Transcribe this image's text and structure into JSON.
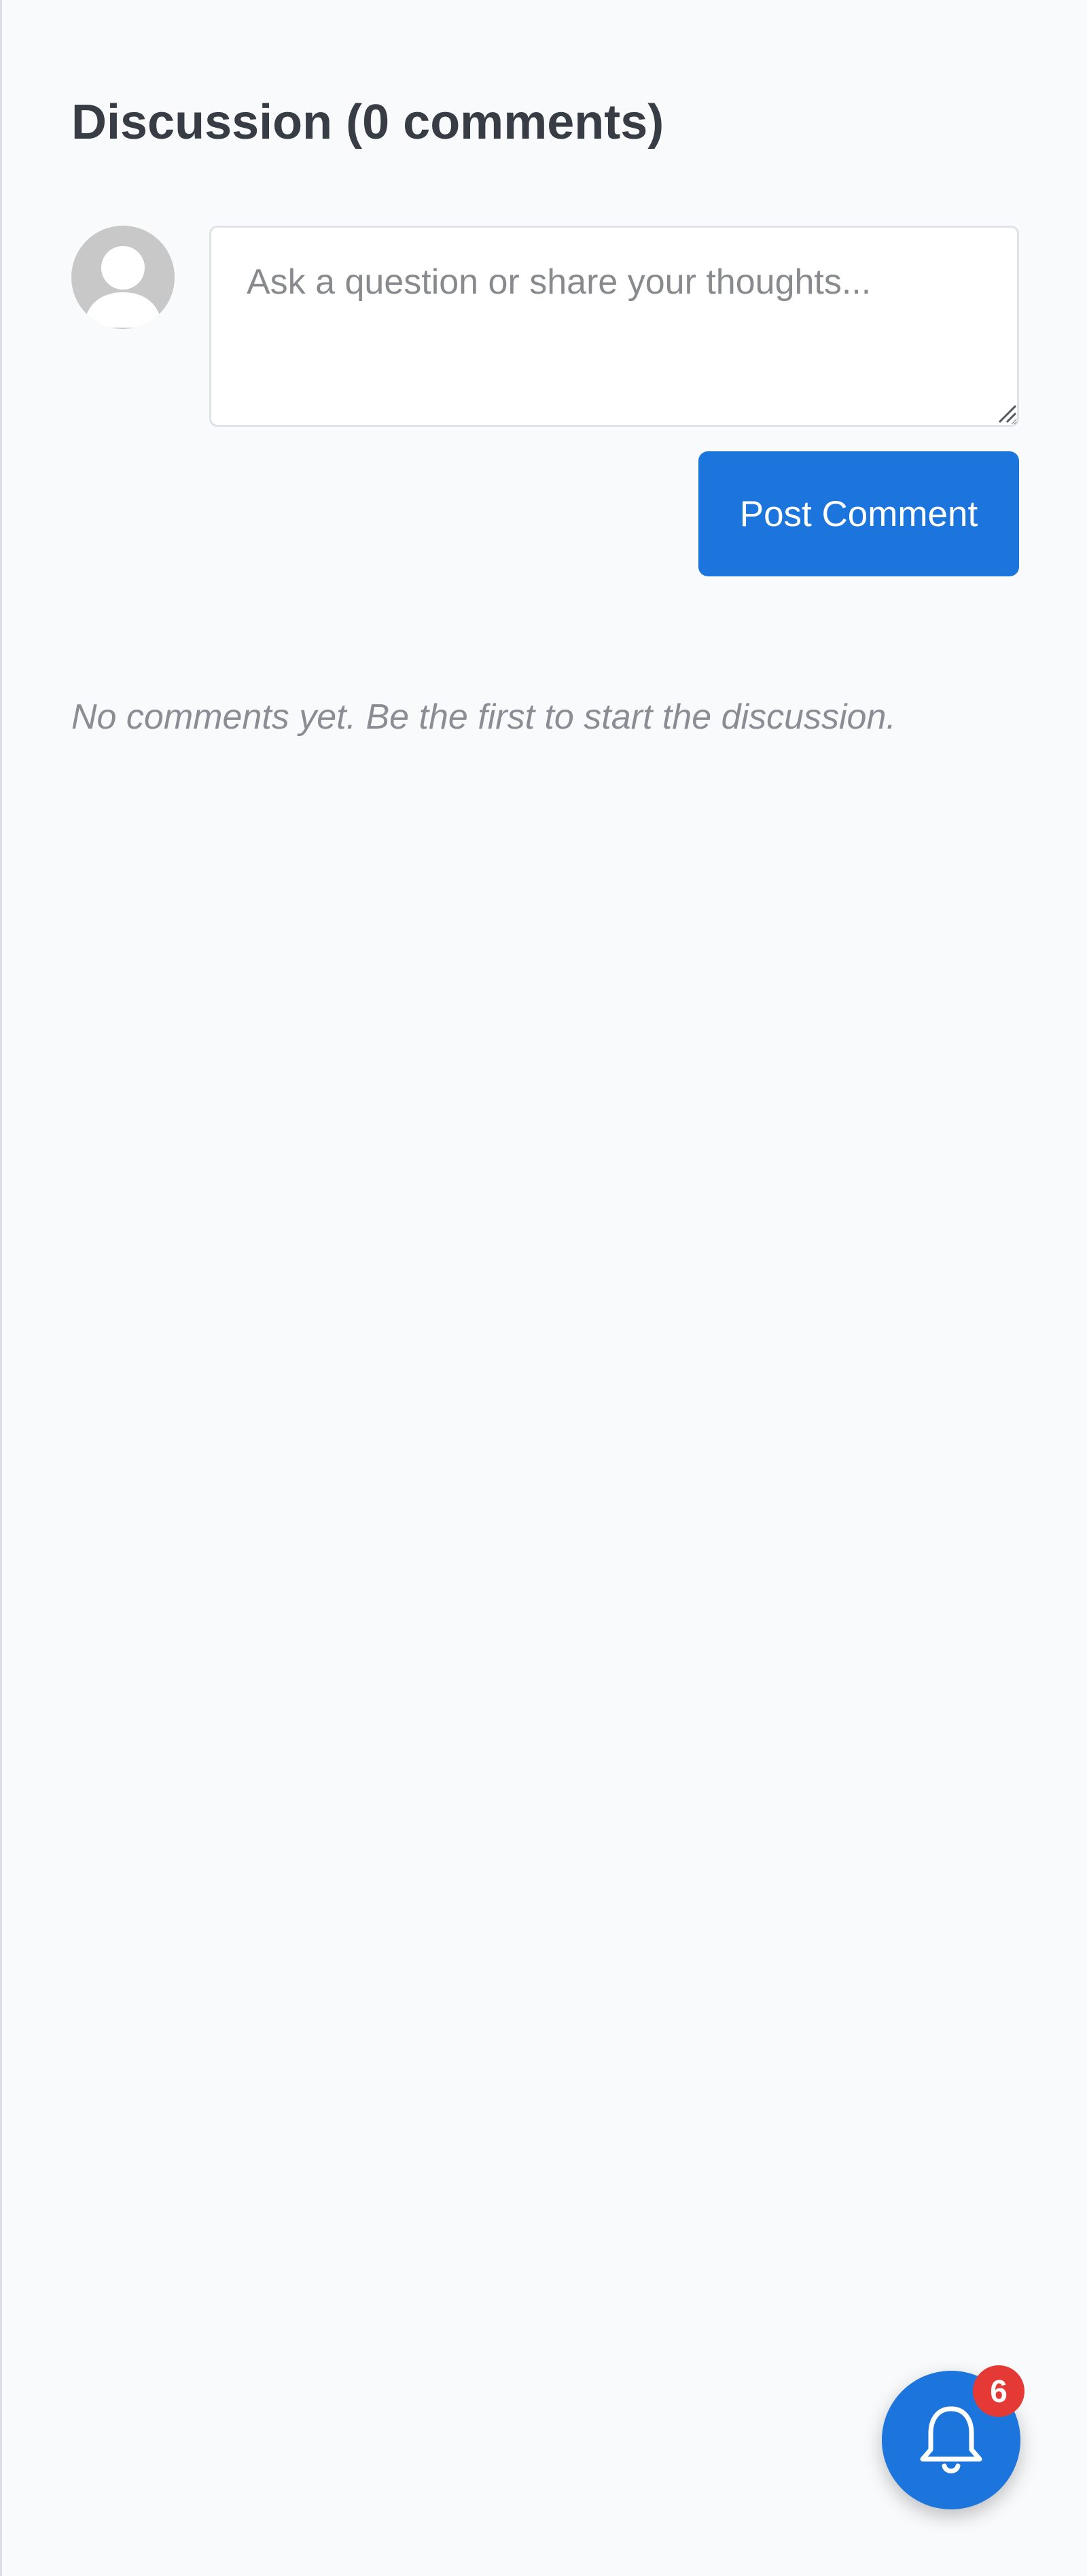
{
  "discussion": {
    "heading": "Discussion (0 comments)",
    "comment_placeholder": "Ask a question or share your thoughts...",
    "post_button_label": "Post Comment",
    "empty_message": "No comments yet. Be the first to start the discussion."
  },
  "notifications": {
    "badge_count": "6",
    "icon": "bell-icon"
  },
  "colors": {
    "accent": "#1c75dc",
    "badge": "#e53935",
    "background": "#f8fafc",
    "heading_text": "#383d45",
    "muted_text": "#8a8d93",
    "avatar": "#c8c8c8"
  }
}
